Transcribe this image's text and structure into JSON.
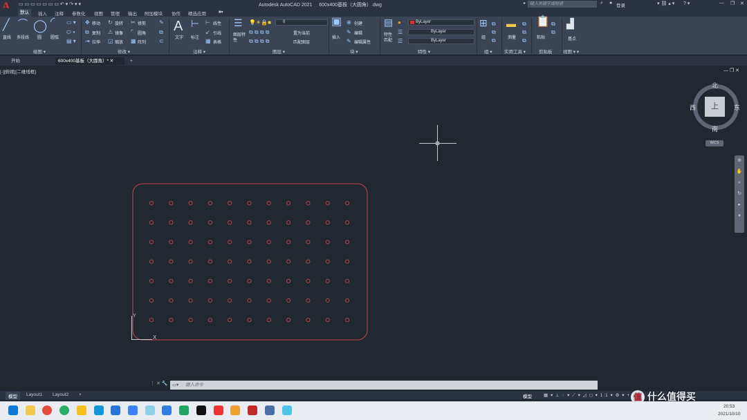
{
  "title_bar": {
    "app": "Autodesk AutoCAD 2021",
    "file": "600x400基板（大圆角）.dwg",
    "search_placeholder": "键入关键字或短语",
    "login": "登录"
  },
  "ribbon_tabs": [
    "默认",
    "插入",
    "注释",
    "参数化",
    "视图",
    "管理",
    "输出",
    "附加模块",
    "协作",
    "精选应用"
  ],
  "ribbon": {
    "draw": {
      "panel": "绘图",
      "line": "直线",
      "polyline": "多段线",
      "circle": "圆",
      "arc": "圆弧"
    },
    "modify": {
      "panel": "修改",
      "move": "移动",
      "rotate": "旋转",
      "trim": "修剪",
      "copy": "复制",
      "mirror": "镜像",
      "fillet": "圆角",
      "stretch": "拉伸",
      "scale": "缩放",
      "array": "阵列"
    },
    "annotation": {
      "panel": "注释",
      "text": "文字",
      "dimension": "标注",
      "linear": "线性",
      "leader": "引线",
      "table": "表格"
    },
    "layers": {
      "panel": "图层",
      "properties": "图层特性",
      "layer_value": "0",
      "make_current": "置为当前",
      "match": "匹配图层"
    },
    "block": {
      "panel": "块",
      "insert": "插入",
      "create": "创建",
      "edit": "编辑",
      "edit_attr": "编辑属性"
    },
    "properties": {
      "panel": "特性",
      "match": "特性匹配",
      "color": "ByLayer",
      "linetype": "ByLayer",
      "lineweight": "ByLayer"
    },
    "groups": {
      "panel": "组",
      "group": "组"
    },
    "utilities": {
      "panel": "实用工具",
      "measure": "测量"
    },
    "clipboard": {
      "panel": "剪贴板",
      "paste": "粘贴"
    },
    "view": {
      "panel": "视图",
      "base": "基点"
    }
  },
  "doc_tabs": [
    "开始",
    "600x400基板（大圆角）*"
  ],
  "viewport_label": "[-][俯视][二维线框]",
  "viewcube": {
    "top": "上",
    "north": "北",
    "south": "南",
    "east": "东",
    "west": "西",
    "wcs": "WCS"
  },
  "ucs": {
    "x": "X",
    "y": "Y"
  },
  "command_placeholder": "键入命令",
  "layout_tabs": [
    "模型",
    "Layout1",
    "Layout2"
  ],
  "status": {
    "model": "模型"
  },
  "clock": {
    "time": "20:53",
    "date": "2021/10/10"
  },
  "watermark": "什么值得买",
  "colors": {
    "hole": "#c2484a",
    "board": "#c2484a",
    "bg": "#212830"
  },
  "board": {
    "rows": 7,
    "cols": 11
  }
}
